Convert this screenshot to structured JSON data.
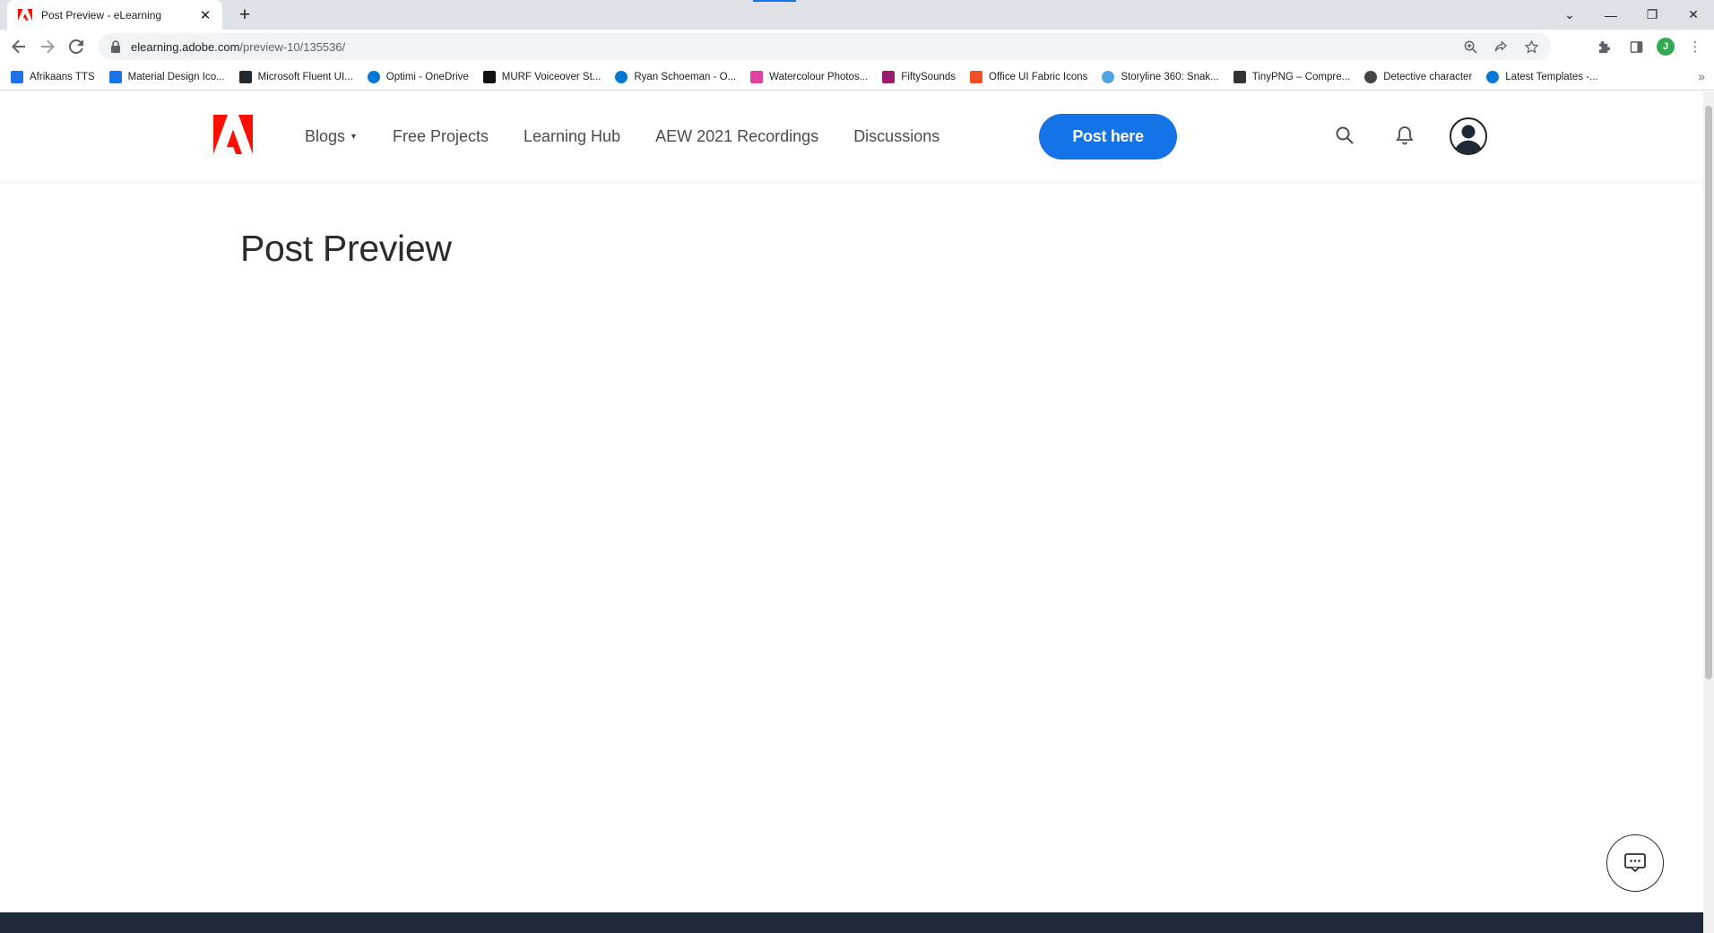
{
  "browser": {
    "tab": {
      "title": "Post Preview - eLearning"
    },
    "url": {
      "domain": "elearning.adobe.com",
      "path": "/preview-10/135536/"
    },
    "bookmarks": [
      {
        "label": "Afrikaans TTS",
        "icon": "microphone-icon",
        "color": "#1a73e8"
      },
      {
        "label": "Material Design Ico...",
        "icon": "material-icon",
        "color": "#1a73e8"
      },
      {
        "label": "Microsoft Fluent UI...",
        "icon": "github-icon",
        "color": "#24292e"
      },
      {
        "label": "Optimi - OneDrive",
        "icon": "onedrive-icon",
        "color": "#0078d4"
      },
      {
        "label": "MURF Voiceover St...",
        "icon": "murf-icon",
        "color": "#111111"
      },
      {
        "label": "Ryan Schoeman - O...",
        "icon": "onedrive-icon",
        "color": "#0078d4"
      },
      {
        "label": "Watercolour Photos...",
        "icon": "photos-icon",
        "color": "#e040a0"
      },
      {
        "label": "FiftySounds",
        "icon": "play-icon",
        "color": "#9c1d6e"
      },
      {
        "label": "Office UI Fabric Icons",
        "icon": "office-icon",
        "color": "#f25022"
      },
      {
        "label": "Storyline 360: Snak...",
        "icon": "shield-icon",
        "color": "#4fa3e0"
      },
      {
        "label": "TinyPNG – Compre...",
        "icon": "panda-icon",
        "color": "#333333"
      },
      {
        "label": "Detective character",
        "icon": "globe-icon",
        "color": "#444444"
      },
      {
        "label": "Latest Templates -...",
        "icon": "onedrive-icon",
        "color": "#0078d4"
      }
    ],
    "profile_initial": "J"
  },
  "site": {
    "nav": {
      "blogs": "Blogs",
      "free_projects": "Free Projects",
      "learning_hub": "Learning Hub",
      "aew": "AEW 2021 Recordings",
      "discussions": "Discussions"
    },
    "post_button": "Post here",
    "brand_color": "#fa0f00",
    "accent_color": "#1473e6"
  },
  "page": {
    "title": "Post Preview"
  }
}
